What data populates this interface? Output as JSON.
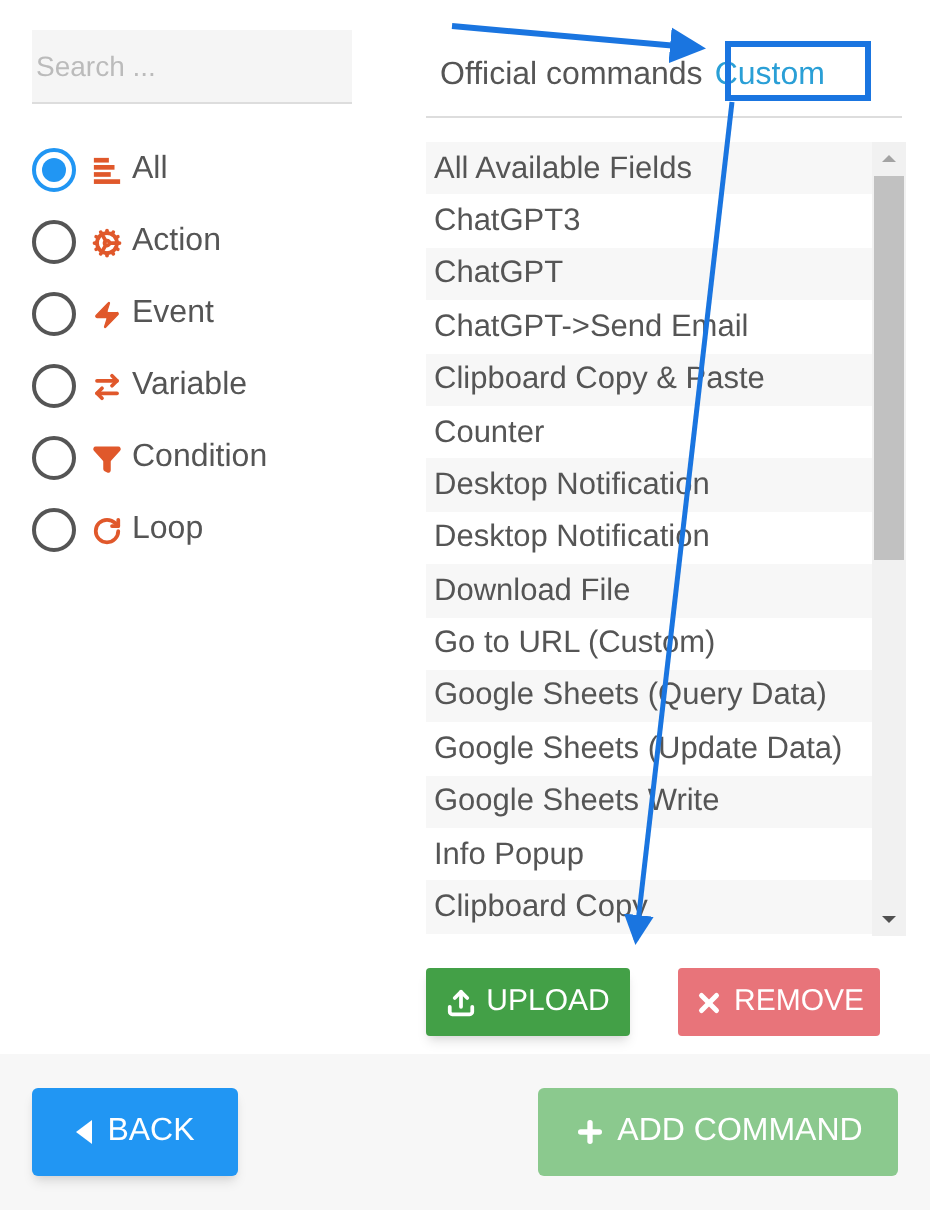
{
  "search": {
    "placeholder": "Search ..."
  },
  "filters": [
    {
      "label": "All",
      "kind": "all",
      "selected": true
    },
    {
      "label": "Action",
      "kind": "action",
      "selected": false
    },
    {
      "label": "Event",
      "kind": "event",
      "selected": false
    },
    {
      "label": "Variable",
      "kind": "variable",
      "selected": false
    },
    {
      "label": "Condition",
      "kind": "condition",
      "selected": false
    },
    {
      "label": "Loop",
      "kind": "loop",
      "selected": false
    }
  ],
  "tabs": [
    {
      "label": "Official commands",
      "selected": false
    },
    {
      "label": "Custom",
      "selected": true
    }
  ],
  "commands": [
    "All Available Fields",
    "ChatGPT3",
    "ChatGPT",
    "ChatGPT->Send Email",
    "Clipboard Copy & Paste",
    "Counter",
    "Desktop Notification",
    "Desktop Notification",
    "Download File",
    "Go to URL (Custom)",
    "Google Sheets (Query Data)",
    "Google Sheets (Update Data)",
    "Google Sheets Write",
    "Info Popup",
    "Clipboard Copy"
  ],
  "upload": {
    "label": "UPLOAD"
  },
  "remove": {
    "label": "REMOVE"
  },
  "back": {
    "label": "BACK"
  },
  "add_command": {
    "label": "ADD COMMAND",
    "disabled": true
  }
}
